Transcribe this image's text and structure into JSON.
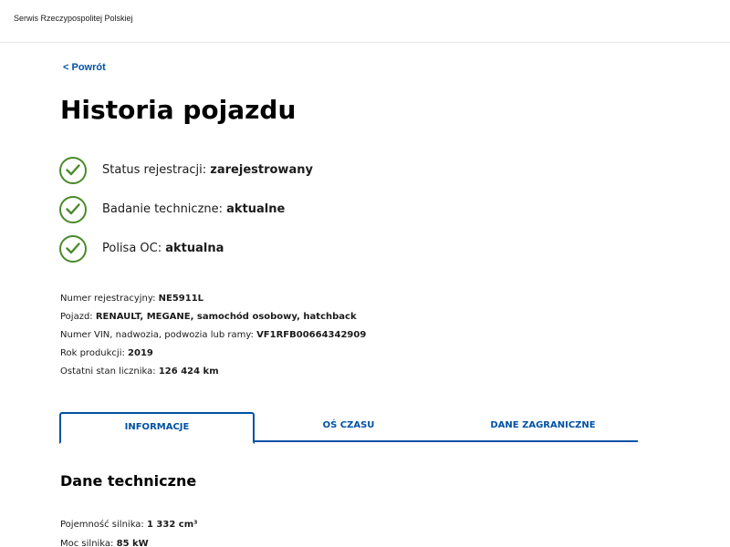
{
  "header": {
    "brand": "Serwis Rzeczypospolitej Polskiej"
  },
  "nav": {
    "back_label": "< Powrót"
  },
  "page": {
    "title": "Historia pojazdu"
  },
  "statuses": [
    {
      "label": "Status rejestracji: ",
      "value": "zarejestrowany",
      "icon": "check-icon",
      "color": "#4a8a2a"
    },
    {
      "label": "Badanie techniczne: ",
      "value": "aktualne",
      "icon": "check-icon",
      "color": "#4a8a2a"
    },
    {
      "label": "Polisa OC: ",
      "value": "aktualna",
      "icon": "check-icon",
      "color": "#4a8a2a"
    }
  ],
  "vehicle": {
    "registration": {
      "label": "Numer rejestracyjny: ",
      "value": "NE5911L"
    },
    "model": {
      "label": "Pojazd: ",
      "value": "RENAULT, MEGANE, samochód osobowy, hatchback"
    },
    "vin": {
      "label": "Numer VIN, nadwozia, podwozia lub ramy: ",
      "value": "VF1RFB00664342909"
    },
    "year": {
      "label": "Rok produkcji: ",
      "value": "2019"
    },
    "mileage": {
      "label": "Ostatni stan licznika: ",
      "value": "126 424 km"
    }
  },
  "tabs": [
    {
      "label": "INFORMACJE",
      "active": true
    },
    {
      "label": "OŚ CZASU",
      "active": false
    },
    {
      "label": "DANE ZAGRANICZNE",
      "active": false
    }
  ],
  "technical": {
    "title": "Dane techniczne",
    "engine_capacity": {
      "label": "Pojemność silnika: ",
      "value": "1 332 cm³"
    },
    "engine_power": {
      "label": "Moc silnika: ",
      "value": "85 kW"
    }
  },
  "colors": {
    "accent": "#0052a5",
    "success": "#4a8a2a"
  }
}
